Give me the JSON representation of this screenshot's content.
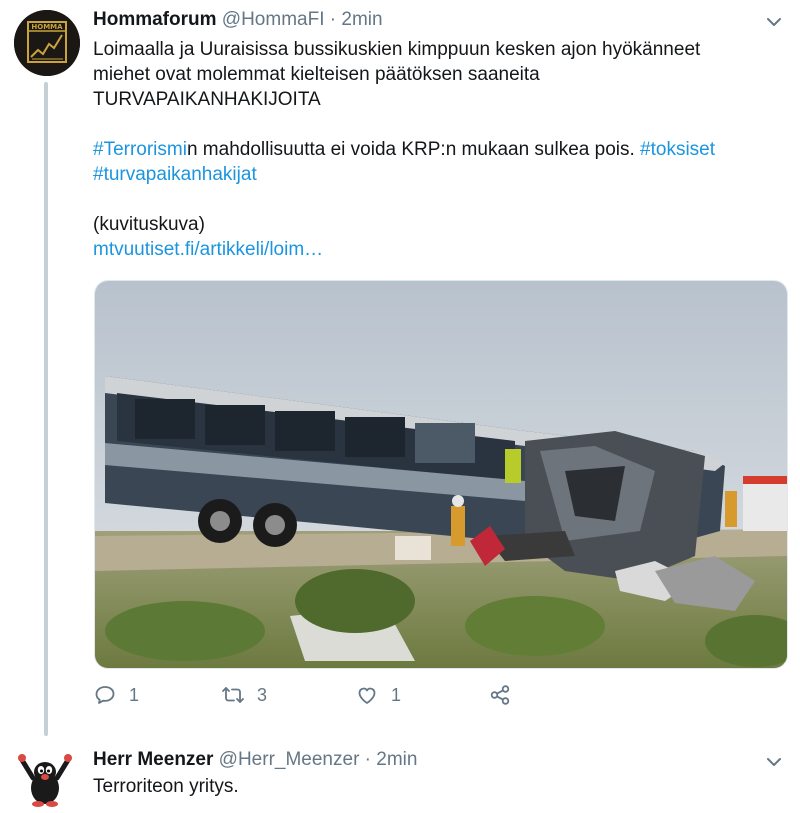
{
  "tweet1": {
    "display_name": "Hommaforum",
    "handle": "@HommaFI",
    "separator": "·",
    "time": "2min",
    "avatar_text": "HOMMA",
    "text_line1": "Loimaalla ja Uuraisissa bussikuskien kimppuun kesken ajon hyökänneet",
    "text_line2": "miehet ovat molemmat kielteisen päätöksen saaneita",
    "text_line3": "TURVAPAIKANHAKIJOITA",
    "hashtag1": "#Terrorismi",
    "text_after_hashtag1": "n mahdollisuutta ei voida KRP:n mukaan sulkea pois.",
    "hashtag2": "#toksiset",
    "hashtag3": "#turvapaikanhakijat",
    "caption": "(kuvituskuva)",
    "link": "mtvuutiset.fi/artikkeli/loim…",
    "image_icon": "bus-crash-photo",
    "reply_count": "1",
    "retweet_count": "3",
    "like_count": "1",
    "icons": {
      "reply": "reply-icon",
      "retweet": "retweet-icon",
      "like": "heart-icon",
      "share": "share-icon",
      "menu": "chevron-down-icon"
    }
  },
  "tweet2": {
    "display_name": "Herr Meenzer",
    "handle": "@Herr_Meenzer",
    "separator": "·",
    "time": "2min",
    "text": "Terroriteon yritys.",
    "avatar_icon": "mole-cartoon-avatar"
  },
  "colors": {
    "link": "#1b95e0",
    "secondary_text": "#657786",
    "primary_text": "#14171a",
    "thread_line": "#c4cfd6",
    "avatar_gold": "#c9a33c"
  }
}
